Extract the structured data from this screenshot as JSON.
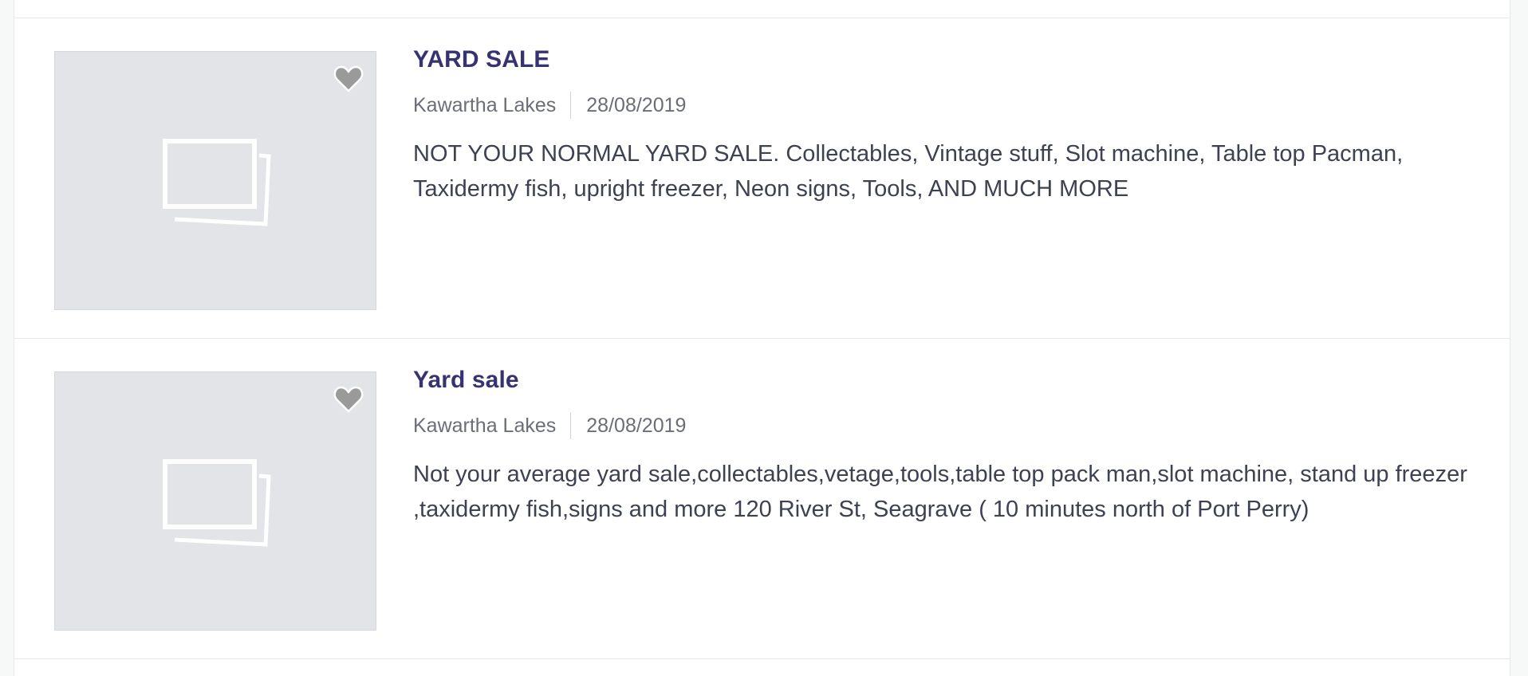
{
  "listings": [
    {
      "title": "YARD SALE",
      "location": "Kawartha Lakes",
      "date": "28/08/2019",
      "description": "NOT YOUR NORMAL YARD SALE. Collectables, Vintage stuff, Slot machine, Table top Pacman, Taxidermy fish, upright freezer, Neon signs, Tools, AND MUCH MORE",
      "image_icon": "image-placeholder-icon",
      "favorite_icon": "heart-icon"
    },
    {
      "title": "Yard sale",
      "location": "Kawartha Lakes",
      "date": "28/08/2019",
      "description": "Not your average yard sale,collectables,vetage,tools,table top pack man,slot machine, stand up freezer ,taxidermy fish,signs and more 120 River St, Seagrave ( 10 minutes north of Port Perry)",
      "image_icon": "image-placeholder-icon",
      "favorite_icon": "heart-icon"
    }
  ],
  "colors": {
    "title": "#373373",
    "meta": "#6b6d78",
    "description": "#3e4152",
    "thumbnail_bg": "#e2e4e8",
    "heart": "#9a9a9a"
  }
}
